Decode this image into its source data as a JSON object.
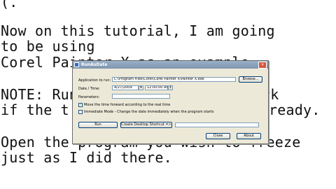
{
  "tutorial": {
    "line0": "(.",
    "line1": "Now on this tutorial, I am going",
    "line2": "to be using",
    "line3": "Corel Painter X as an example.",
    "line4": "NOTE: Run",
    "line5": "if the t",
    "line4_end": "rk",
    "line5_end": "ready.",
    "line6": "Open the program you wish to freeze",
    "line7": "just as I did there."
  },
  "dialog": {
    "title": "RunAsDate",
    "close_glyph": "×",
    "app_label": "Application to run:",
    "app_value": "C:\\Program Files\\Corel\\Corel Painter X\\Painter X.exe",
    "browse_label": "Browse...",
    "datetime_label": "Date / Time:",
    "date_value": "4/27/2009",
    "time_value": "12:00:00 AM",
    "params_label": "Parameters:",
    "params_value": "",
    "move_forward_label": "Move the time forward according to the real time",
    "immediate_label": "Immediate Mode - Change the date immediately when the program starts",
    "run_label": "Run",
    "shortcut_label": "Create Desktop Shortcut =>",
    "shortcut_value": "",
    "close_label": "Close",
    "about_label": "About"
  }
}
